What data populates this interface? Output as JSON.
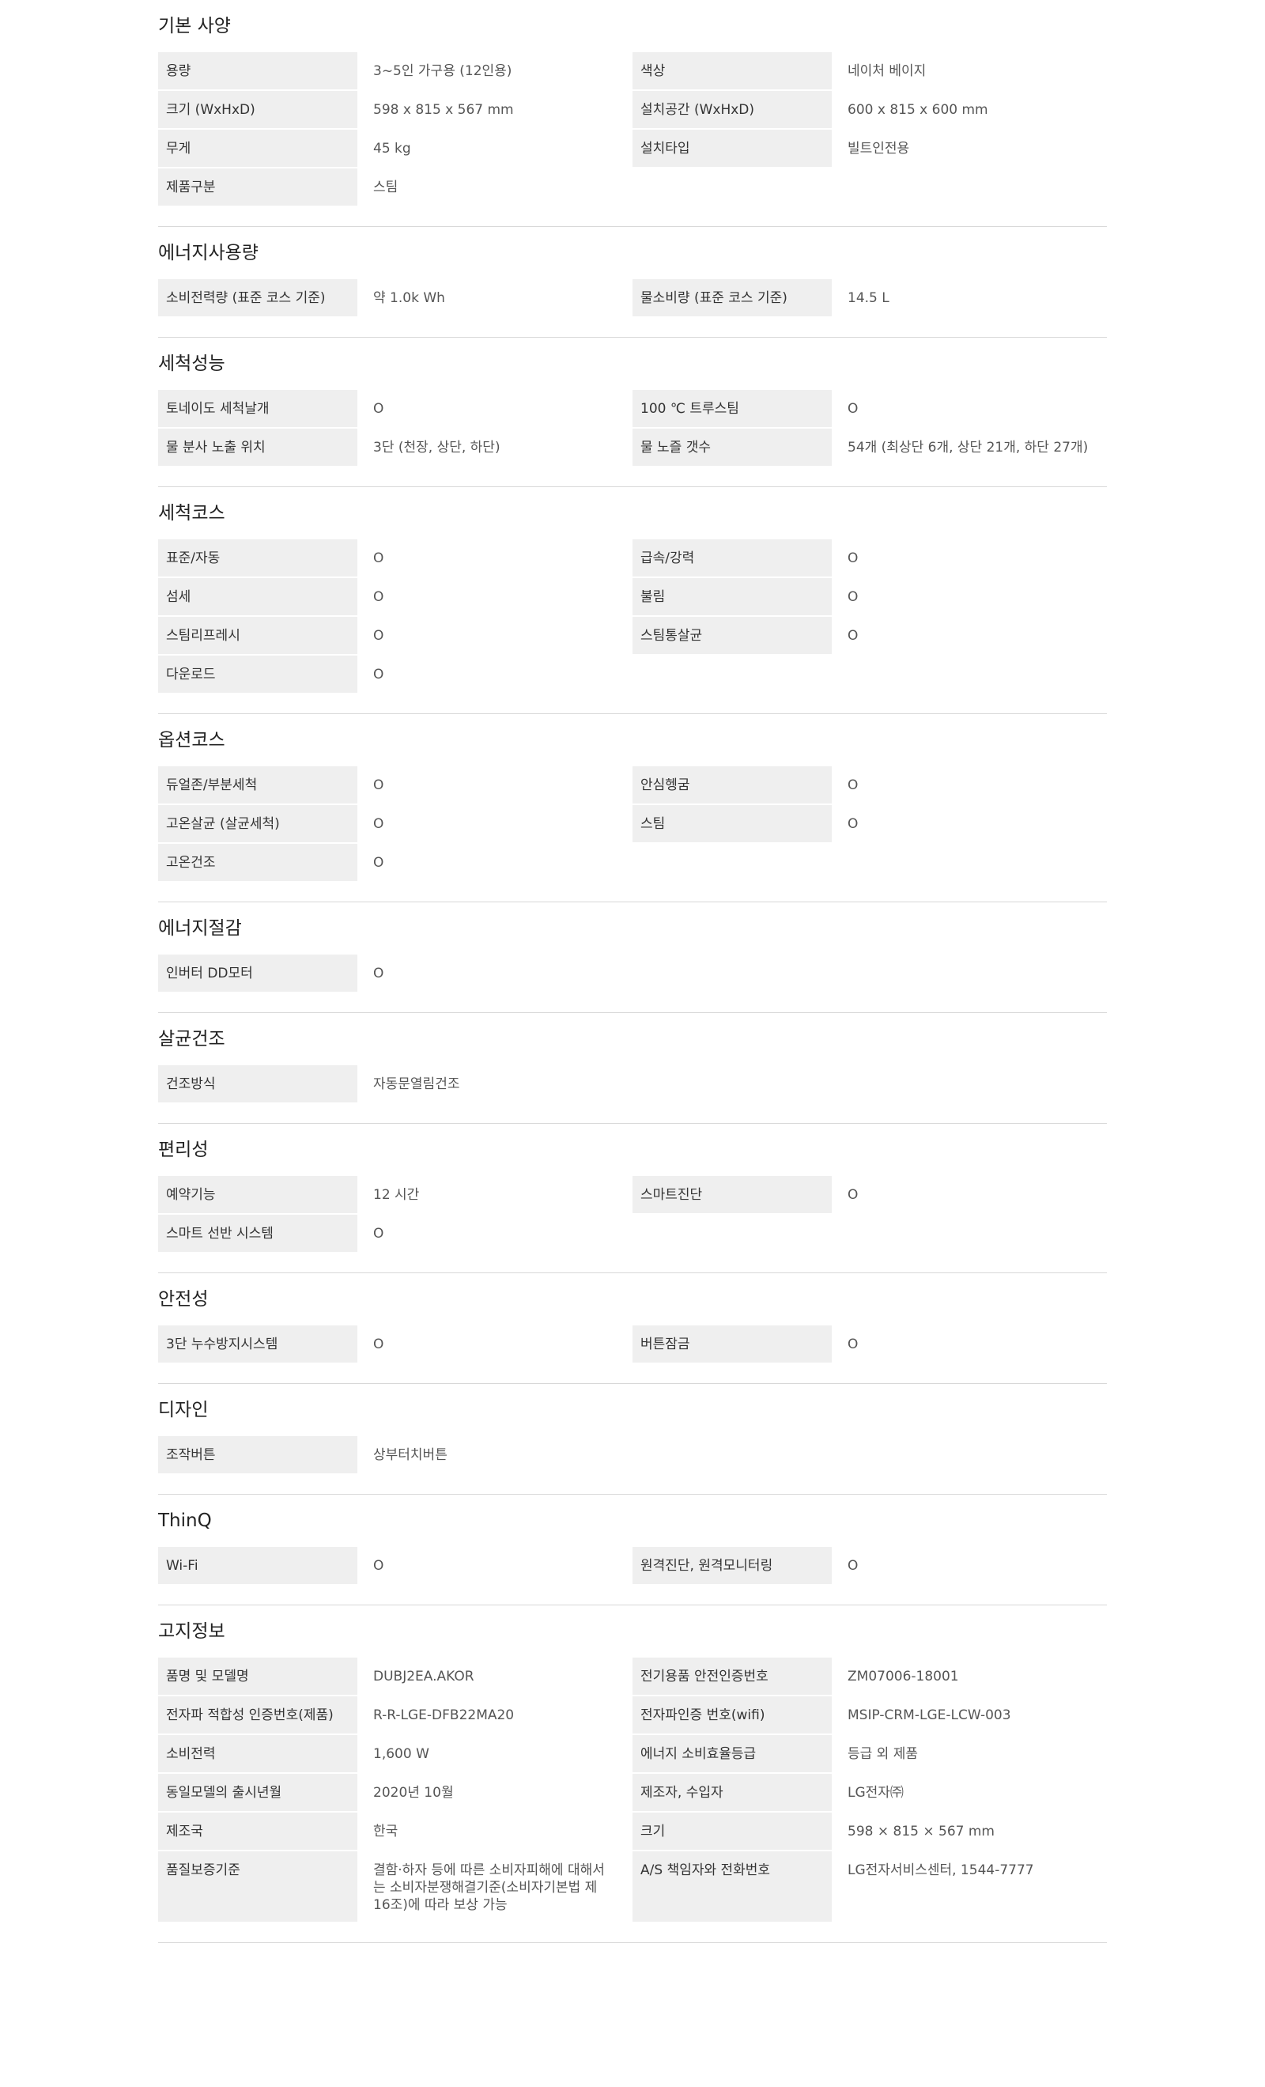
{
  "sections": [
    {
      "title": "기본 사양",
      "rows": [
        [
          {
            "label": "용량",
            "value": "3~5인 가구용 (12인용)"
          },
          {
            "label": "색상",
            "value": "네이처 베이지"
          }
        ],
        [
          {
            "label": "크기 (WxHxD)",
            "value": "598 x 815 x 567 mm"
          },
          {
            "label": "설치공간 (WxHxD)",
            "value": "600 x 815 x 600 mm"
          }
        ],
        [
          {
            "label": "무게",
            "value": "45 kg"
          },
          {
            "label": "설치타입",
            "value": "빌트인전용"
          }
        ],
        [
          {
            "label": "제품구분",
            "value": "스팀"
          }
        ]
      ]
    },
    {
      "title": "에너지사용량",
      "rows": [
        [
          {
            "label": "소비전력량 (표준 코스 기준)",
            "value": "약 1.0k Wh"
          },
          {
            "label": "물소비량 (표준 코스 기준)",
            "value": "14.5 L"
          }
        ]
      ]
    },
    {
      "title": "세척성능",
      "rows": [
        [
          {
            "label": "토네이도 세척날개",
            "value": "O"
          },
          {
            "label": "100 ℃ 트루스팀",
            "value": "O"
          }
        ],
        [
          {
            "label": "물 분사 노출 위치",
            "value": "3단 (천장, 상단, 하단)"
          },
          {
            "label": "물 노즐 갯수",
            "value": "54개 (최상단 6개, 상단 21개, 하단 27개)"
          }
        ]
      ]
    },
    {
      "title": "세척코스",
      "rows": [
        [
          {
            "label": "표준/자동",
            "value": "O"
          },
          {
            "label": "급속/강력",
            "value": "O"
          }
        ],
        [
          {
            "label": "섬세",
            "value": "O"
          },
          {
            "label": "불림",
            "value": "O"
          }
        ],
        [
          {
            "label": "스팀리프레시",
            "value": "O"
          },
          {
            "label": "스팀통살균",
            "value": "O"
          }
        ],
        [
          {
            "label": "다운로드",
            "value": "O"
          }
        ]
      ]
    },
    {
      "title": "옵션코스",
      "rows": [
        [
          {
            "label": "듀얼존/부분세척",
            "value": "O"
          },
          {
            "label": "안심헹굼",
            "value": "O"
          }
        ],
        [
          {
            "label": "고온살균 (살균세척)",
            "value": "O"
          },
          {
            "label": "스팀",
            "value": "O"
          }
        ],
        [
          {
            "label": "고온건조",
            "value": "O"
          }
        ]
      ]
    },
    {
      "title": "에너지절감",
      "rows": [
        [
          {
            "label": "인버터 DD모터",
            "value": "O"
          }
        ]
      ]
    },
    {
      "title": "살균건조",
      "rows": [
        [
          {
            "label": "건조방식",
            "value": "자동문열림건조"
          }
        ]
      ]
    },
    {
      "title": "편리성",
      "rows": [
        [
          {
            "label": "예약기능",
            "value": "12 시간"
          },
          {
            "label": "스마트진단",
            "value": "O"
          }
        ],
        [
          {
            "label": "스마트 선반 시스템",
            "value": "O"
          }
        ]
      ]
    },
    {
      "title": "안전성",
      "rows": [
        [
          {
            "label": "3단 누수방지시스템",
            "value": "O"
          },
          {
            "label": "버튼잠금",
            "value": "O"
          }
        ]
      ]
    },
    {
      "title": "디자인",
      "rows": [
        [
          {
            "label": "조작버튼",
            "value": "상부터치버튼"
          }
        ]
      ]
    },
    {
      "title": "ThinQ",
      "rows": [
        [
          {
            "label": "Wi-Fi",
            "value": "O"
          },
          {
            "label": "원격진단, 원격모니터링",
            "value": "O"
          }
        ]
      ]
    },
    {
      "title": "고지정보",
      "rows": [
        [
          {
            "label": "품명 및 모델명",
            "value": "DUBJ2EA.AKOR"
          },
          {
            "label": "전기용품 안전인증번호",
            "value": "ZM07006-18001"
          }
        ],
        [
          {
            "label": "전자파 적합성 인증번호(제품)",
            "value": "R-R-LGE-DFB22MA20"
          },
          {
            "label": "전자파인증 번호(wifi)",
            "value": "MSIP-CRM-LGE-LCW-003"
          }
        ],
        [
          {
            "label": "소비전력",
            "value": "1,600 W"
          },
          {
            "label": "에너지 소비효율등급",
            "value": "등급 외 제품"
          }
        ],
        [
          {
            "label": "동일모델의 출시년월",
            "value": "2020년 10월"
          },
          {
            "label": "제조자, 수입자",
            "value": "LG전자㈜"
          }
        ],
        [
          {
            "label": "제조국",
            "value": "한국"
          },
          {
            "label": "크기",
            "value": "598 × 815 × 567 mm"
          }
        ],
        [
          {
            "label": "품질보증기준",
            "value": "결함·하자 등에 따른 소비자피해에 대해서\n는 소비자분쟁해결기준(소비자기본법 제\n16조)에 따라 보상 가능"
          },
          {
            "label": "A/S 책임자와 전화번호",
            "value": "LG전자서비스센터, 1544-7777"
          }
        ]
      ]
    }
  ]
}
